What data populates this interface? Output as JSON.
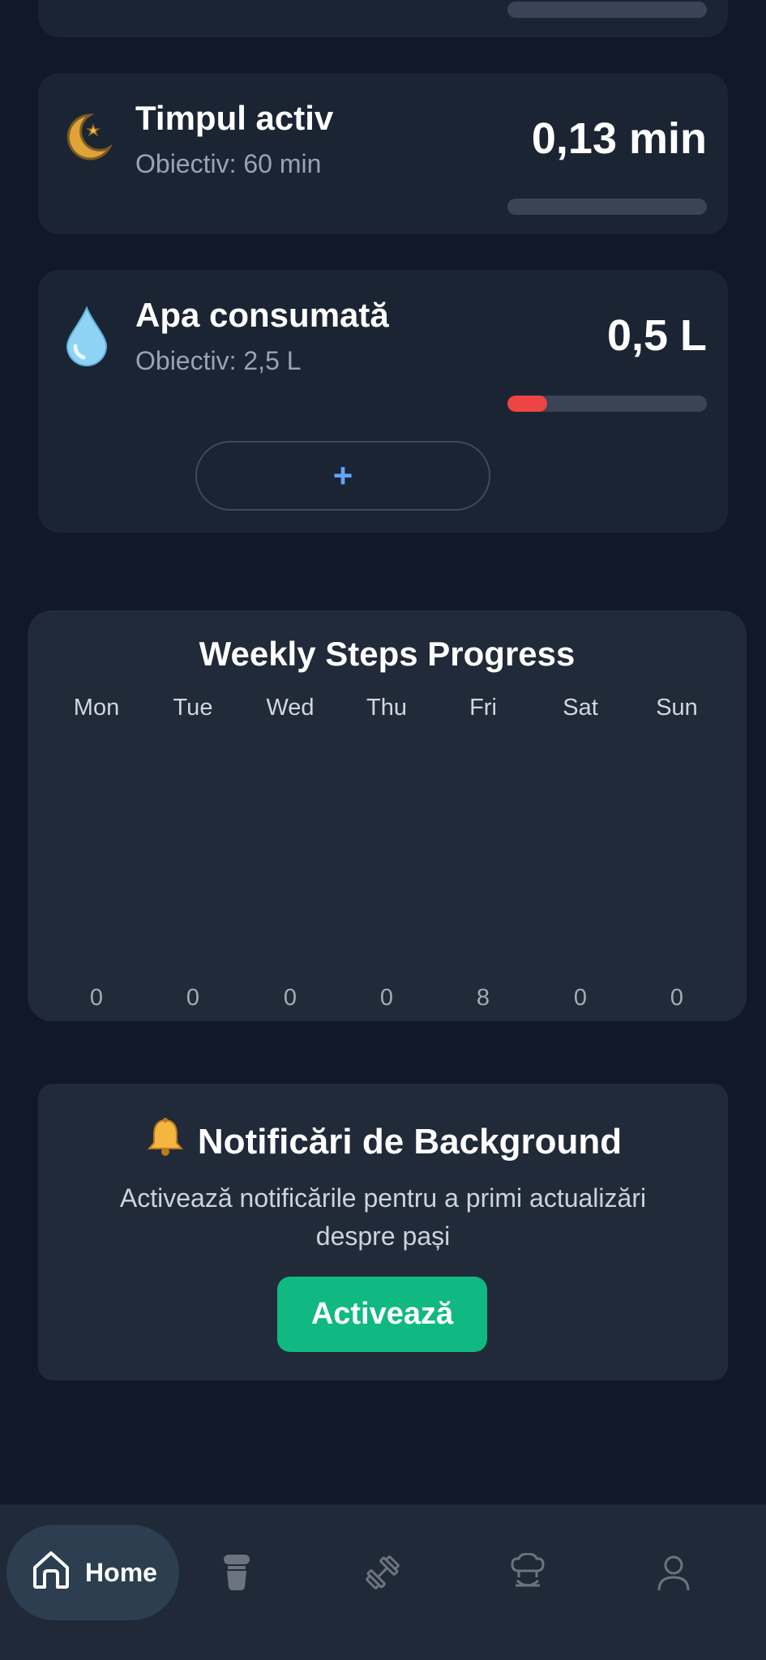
{
  "cards": {
    "active_time": {
      "title": "Timpul activ",
      "goal": "Obiectiv: 60 min",
      "value": "0,13 min",
      "icon": "moon-icon",
      "progress": 0
    },
    "water": {
      "title": "Apa consumată",
      "goal": "Obiectiv: 2,5 L",
      "value": "0,5 L",
      "icon": "water-drop-icon",
      "progress": 0.2,
      "progress_color": "#ef4444",
      "add_label": "+"
    }
  },
  "weekly": {
    "title": "Weekly Steps Progress",
    "days": [
      "Mon",
      "Tue",
      "Wed",
      "Thu",
      "Fri",
      "Sat",
      "Sun"
    ],
    "values": [
      "0",
      "0",
      "0",
      "0",
      "8",
      "0",
      "0"
    ]
  },
  "chart_data": {
    "type": "bar",
    "title": "Weekly Steps Progress",
    "categories": [
      "Mon",
      "Tue",
      "Wed",
      "Thu",
      "Fri",
      "Sat",
      "Sun"
    ],
    "values": [
      0,
      0,
      0,
      0,
      8,
      0,
      0
    ]
  },
  "notifications": {
    "icon": "bell-icon",
    "title": "Notificări de Background",
    "description": "Activează notificările pentru a primi actualizări despre pași",
    "button_label": "Activează",
    "button_color": "#10b981"
  },
  "nav": {
    "home_label": "Home",
    "items": [
      "home-icon",
      "shaker-icon",
      "dumbbell-icon",
      "chef-icon",
      "profile-icon"
    ]
  }
}
